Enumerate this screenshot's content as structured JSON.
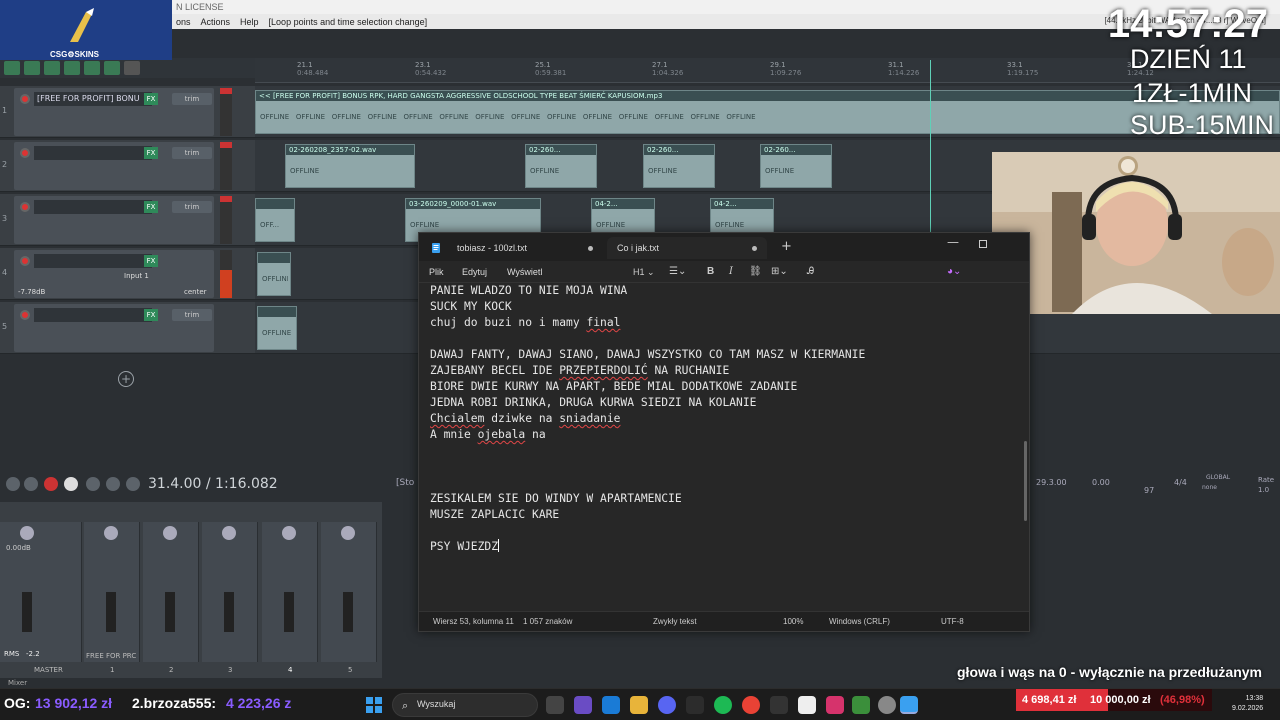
{
  "daw": {
    "title_fragment": "N LICENSE",
    "menu": [
      "ons",
      "Actions",
      "Help",
      "[Loop points and time selection change]"
    ],
    "status_right": "[44.1kHz 24bit WAV : 2ch 44...18 r] WaveOut]",
    "ruler": [
      {
        "bar": "21.1",
        "time": "0:48.484"
      },
      {
        "bar": "23.1",
        "time": "0:54.432"
      },
      {
        "bar": "25.1",
        "time": "0:59.381"
      },
      {
        "bar": "27.1",
        "time": "1:04.326"
      },
      {
        "bar": "29.1",
        "time": "1:09.276"
      },
      {
        "bar": "31.1",
        "time": "1:14.226"
      },
      {
        "bar": "33.1",
        "time": "1:19.175"
      },
      {
        "bar": "35.1",
        "time": "1:24.12"
      }
    ],
    "tracks": [
      {
        "num": "1",
        "name": "[FREE FOR PROFIT] BONU",
        "fx": "FX",
        "trim": "trim"
      },
      {
        "num": "2",
        "name": "",
        "fx": "FX",
        "trim": "trim"
      },
      {
        "num": "3",
        "name": "",
        "fx": "FX",
        "trim": "trim"
      },
      {
        "num": "4",
        "name": "",
        "fx": "FX",
        "trim": "trim",
        "volume": "-7.78dB",
        "input": "Input 1",
        "pan": "center"
      },
      {
        "num": "5",
        "name": "",
        "fx": "FX",
        "trim": "trim"
      }
    ],
    "clips": {
      "track1_title": "<< [FREE FOR PROFIT] BONUS RPK, HARD GANGSTA AGGRESSIVE OLDSCHOOL TYPE BEAT ŚMIERĆ KAPUSIOM.mp3",
      "track2_titles": [
        "02-260208_2357-02.wav",
        "02-260...",
        "02-260...",
        "02-260..."
      ],
      "track3_titles": [
        "03-260209_0000-01.wav",
        "04-2...",
        "04-2..."
      ],
      "offline_label": "OFFLINE",
      "offline_short": "OFF..."
    },
    "transport_time": "31.4.00 / 1:16.082",
    "stop_fragment": "[Sto",
    "right_readouts": [
      "29.3.00",
      "0.00",
      "97",
      "4/4",
      "GLOBAL",
      "none",
      "Rate",
      "1.0"
    ],
    "mixer": {
      "master_label": "MASTER",
      "master_value": "0.00dB",
      "rms": "RMS",
      "rms_value": "-2.2",
      "strip_name": "FREE FOR PRC",
      "strip_numbers": [
        "1",
        "2",
        "3",
        "4",
        "5"
      ],
      "tab_label": "Mixer"
    }
  },
  "overlay": {
    "logo_text": "CSG⚙SKINS",
    "clock": "14:57:27",
    "day": "DZIEŃ 11",
    "rate1": "1ZŁ-1MIN",
    "rate2": "SUB-15MIN",
    "ticker": "głowa i wąs na 0 - wyłącznie na przedłużanym"
  },
  "notepad": {
    "tabs": [
      {
        "label": "tobiasz - 100zl.txt",
        "active": false
      },
      {
        "label": "Co i jak.txt",
        "active": true
      }
    ],
    "new_tab": "+",
    "menu": [
      "Plik",
      "Edytuj",
      "Wyświetl"
    ],
    "heading_dropdown": "H1",
    "lines": [
      "PANIE WLADZO TO NIE MOJA WINA",
      "SUCK MY KOCK",
      "chuj do buzi no i mamy final",
      "",
      "DAWAJ FANTY, DAWAJ SIANO, DAWAJ WSZYSTKO CO TAM MASZ W KIERMANIE",
      "ZAJEBANY BECEL IDE PRZEPIERDOLIĆ NA RUCHANIE",
      "BIORE DWIE KURWY NA APART, BEDE MIAL DODATKOWE ZADANIE",
      "JEDNA ROBI DRINKA, DRUGA KURWA SIEDZI NA KOLANIE",
      "Chcialem dziwke na sniadanie",
      "A mnie ojebala na",
      "",
      "",
      "",
      "ZESIKALEM SIE DO WINDY W APARTAMENCIE",
      "MUSZE ZAPLACIC KARE",
      "",
      "PSY WJEZDZ"
    ],
    "status": {
      "position": "Wiersz 53, kolumna 11",
      "chars": "1 057 znaków",
      "format": "Zwykły tekst",
      "zoom": "100%",
      "line_ending": "Windows (CRLF)",
      "encoding": "UTF-8"
    }
  },
  "taskbar": {
    "donor1_name": "OG:",
    "donor1_amount": "13 902,12 zł",
    "donor2_name": "2.brzoza555:",
    "donor2_amount": "4 223,26 z",
    "search_placeholder": "Wyszukaj",
    "goal_current": "4 698,41 zł",
    "goal_target": "10 000,00 zł",
    "goal_percent": "(46,98%)",
    "goal_fraction": 0.4698,
    "time": "13:38",
    "date": "9.02.2026"
  },
  "colors": {
    "notepad_bg": "#272727",
    "accent_green": "#2f8a5a",
    "donation_purple": "#8a5cff",
    "goal_red": "#e0303a",
    "spell_red": "#e04646"
  }
}
